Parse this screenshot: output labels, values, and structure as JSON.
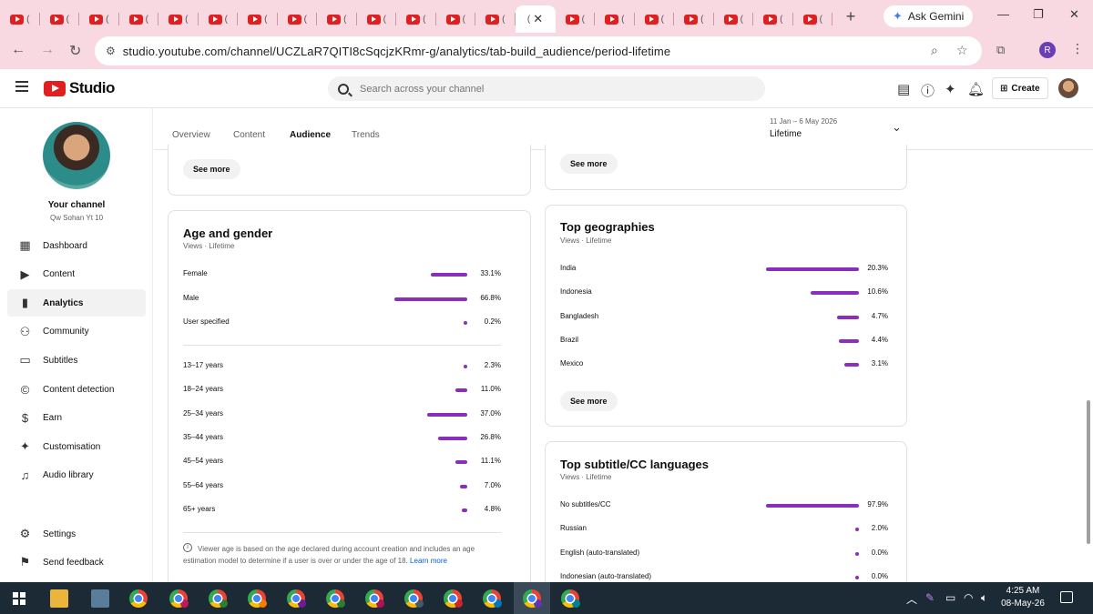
{
  "browser": {
    "tab_count_left": 13,
    "tab_count_right": 7,
    "newtab_label": "+",
    "gemini_label": "Ask Gemini",
    "url": "studio.youtube.com/channel/UCZLaR7QITI8cSqcjzKRmr-g/analytics/tab-build_audience/period-lifetime",
    "profile_initial": "R"
  },
  "header": {
    "logo_text": "Studio",
    "search_placeholder": "Search across your channel",
    "create_label": "Create"
  },
  "sidebar": {
    "your_channel": "Your channel",
    "channel_name": "Qw Sohan Yt 10",
    "items": [
      {
        "label": "Dashboard",
        "icon": "dashboard-icon"
      },
      {
        "label": "Content",
        "icon": "content-icon"
      },
      {
        "label": "Analytics",
        "icon": "analytics-icon",
        "active": true
      },
      {
        "label": "Community",
        "icon": "community-icon"
      },
      {
        "label": "Subtitles",
        "icon": "subtitles-icon"
      },
      {
        "label": "Content detection",
        "icon": "copyright-icon"
      },
      {
        "label": "Earn",
        "icon": "dollar-icon"
      },
      {
        "label": "Customisation",
        "icon": "wand-icon"
      },
      {
        "label": "Audio library",
        "icon": "audio-library-icon"
      }
    ],
    "settings": "Settings",
    "send_feedback": "Send feedback"
  },
  "tabs": {
    "overview": "Overview",
    "content": "Content",
    "audience": "Audience",
    "trends": "Trends"
  },
  "period": {
    "range": "11 Jan – 6 May 2026",
    "label": "Lifetime"
  },
  "see_more": "See more",
  "age_gender": {
    "title": "Age and gender",
    "subtitle": "Views · Lifetime",
    "gender": [
      {
        "label": "Female",
        "value": "33.1%",
        "pct": 33.1
      },
      {
        "label": "Male",
        "value": "66.8%",
        "pct": 66.8
      },
      {
        "label": "User specified",
        "value": "0.2%",
        "pct": 0.2
      }
    ],
    "ages": [
      {
        "label": "13–17 years",
        "value": "2.3%",
        "pct": 2.3
      },
      {
        "label": "18–24 years",
        "value": "11.0%",
        "pct": 11.0
      },
      {
        "label": "25–34 years",
        "value": "37.0%",
        "pct": 37.0
      },
      {
        "label": "35–44 years",
        "value": "26.8%",
        "pct": 26.8
      },
      {
        "label": "45–54 years",
        "value": "11.1%",
        "pct": 11.1
      },
      {
        "label": "55–64 years",
        "value": "7.0%",
        "pct": 7.0
      },
      {
        "label": "65+ years",
        "value": "4.8%",
        "pct": 4.8
      }
    ],
    "note": "Viewer age is based on the age declared during account creation and includes an age estimation model to determine if a user is over or under the age of 18.",
    "learn_more": "Learn more"
  },
  "geographies": {
    "title": "Top geographies",
    "subtitle": "Views · Lifetime",
    "rows": [
      {
        "label": "India",
        "value": "20.3%",
        "pct": 20.3
      },
      {
        "label": "Indonesia",
        "value": "10.6%",
        "pct": 10.6
      },
      {
        "label": "Bangladesh",
        "value": "4.7%",
        "pct": 4.7
      },
      {
        "label": "Brazil",
        "value": "4.4%",
        "pct": 4.4
      },
      {
        "label": "Mexico",
        "value": "3.1%",
        "pct": 3.1
      }
    ]
  },
  "subtitles": {
    "title": "Top subtitle/CC languages",
    "subtitle": "Views · Lifetime",
    "rows": [
      {
        "label": "No subtitles/CC",
        "value": "97.9%",
        "pct": 97.9
      },
      {
        "label": "Russian",
        "value": "2.0%",
        "pct": 2.0
      },
      {
        "label": "English (auto-translated)",
        "value": "0.0%",
        "pct": 0.0
      },
      {
        "label": "Indonesian (auto-translated)",
        "value": "0.0%",
        "pct": 0.0
      }
    ]
  },
  "taskbar": {
    "time": "4:25 AM",
    "date": "08-May-26"
  },
  "colors": {
    "accent_bar": "#8a2fbd",
    "chrome_bg": "#f9d9e1",
    "taskbar_bg": "#1c2a36"
  }
}
